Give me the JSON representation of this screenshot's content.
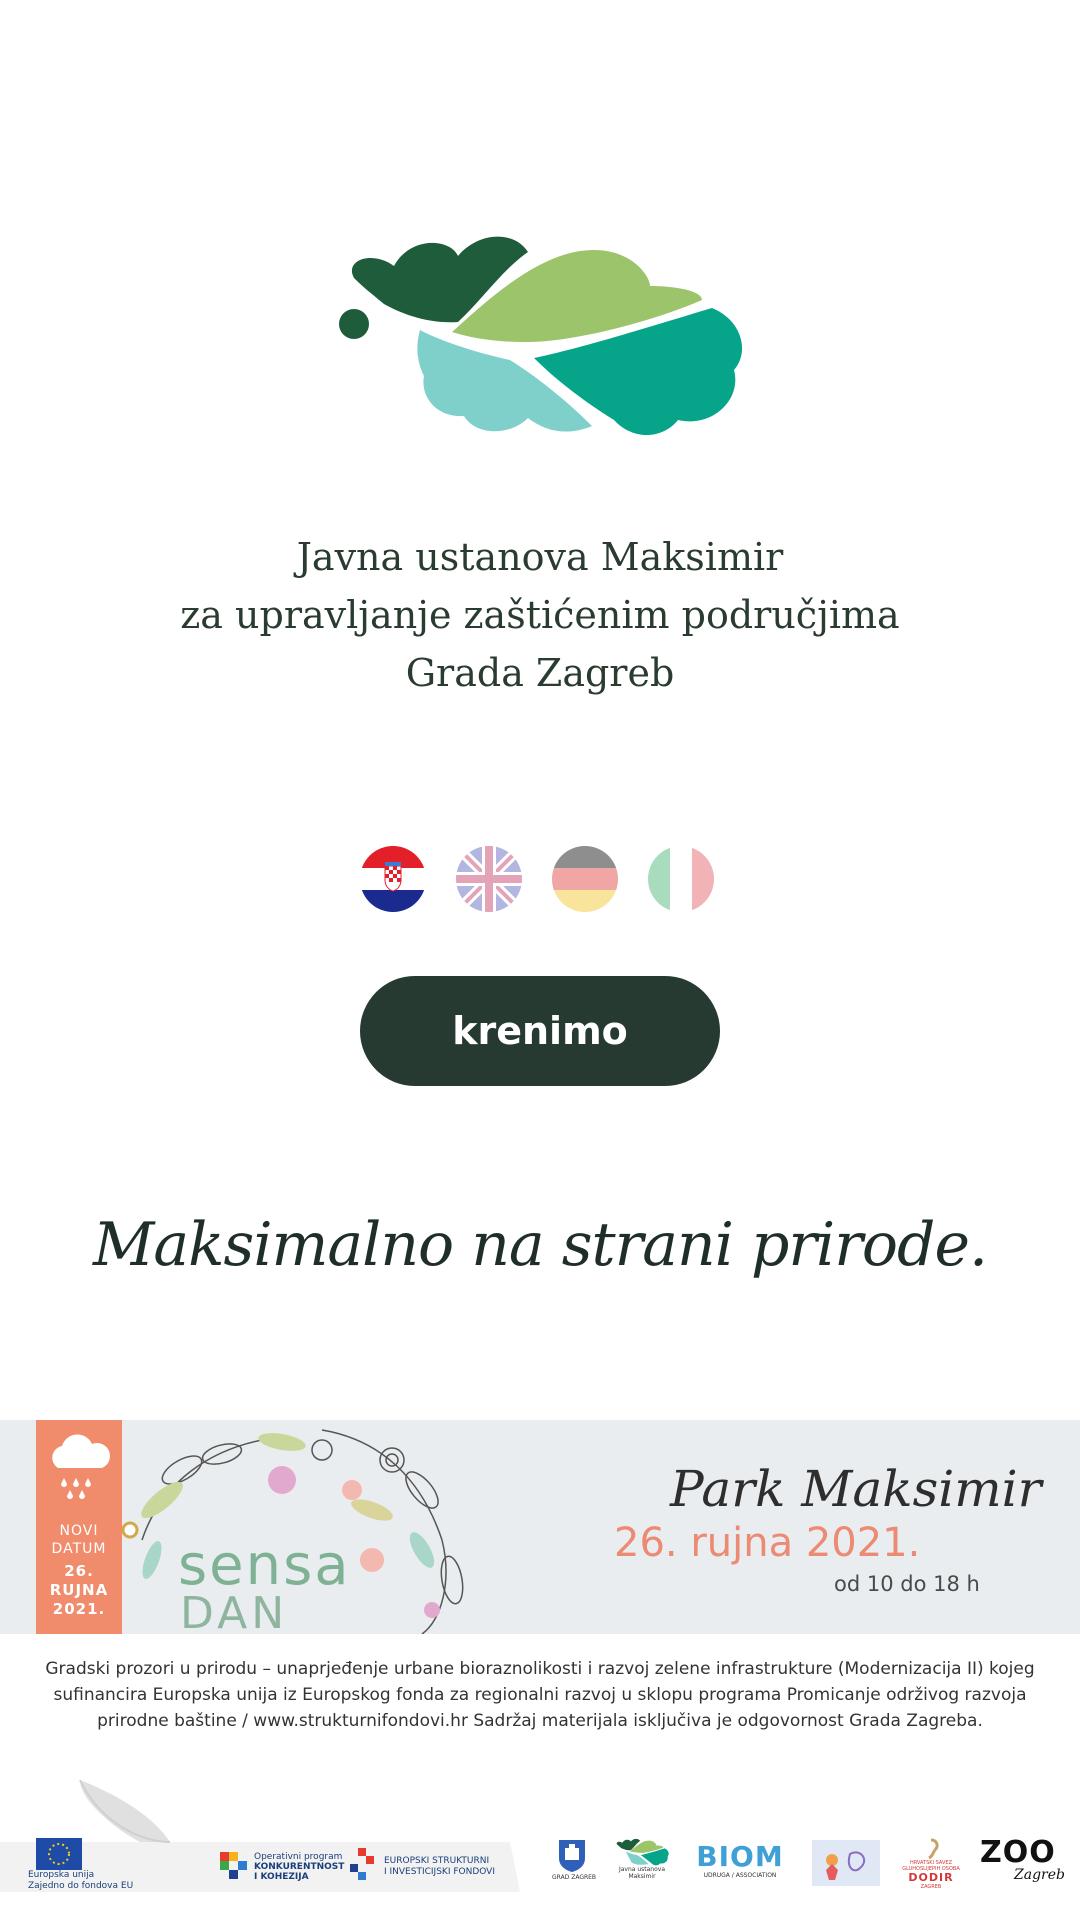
{
  "organization": {
    "title_lines": [
      "Javna ustanova Maksimir",
      "za upravljanje zaštićenim područjima",
      "Grada Zagreb"
    ]
  },
  "languages": [
    {
      "code": "hr",
      "icon": "croatia-flag-icon"
    },
    {
      "code": "en",
      "icon": "uk-flag-icon"
    },
    {
      "code": "de",
      "icon": "germany-flag-icon"
    },
    {
      "code": "it",
      "icon": "italy-flag-icon"
    }
  ],
  "cta": {
    "label": "krenimo"
  },
  "slogan": "Maksimalno na strani prirode.",
  "banner": {
    "calendar_novi": "NOVI",
    "calendar_datum": "DATUM",
    "calendar_day": "26.",
    "calendar_month": "RUJNA",
    "calendar_year": "2021.",
    "event_name_1": "sensa",
    "event_name_2": "DAN",
    "park": "Park Maksimir",
    "date": "26. rujna 2021.",
    "time": "od 10 do 18 h"
  },
  "funding_text": [
    "Gradski prozori u prirodu – unaprjeđenje urbane bioraznolikosti i razvoj zelene infrastrukture (Modernizacija II) kojeg",
    "sufinancira Europska unija iz Europskog fonda za regionalni razvoj u sklopu programa Promicanje održivog razvoja",
    "prirodne baštine / www.strukturnifondovi.hr        Sadržaj materijala isključiva je odgovornost Grada Zagreba."
  ],
  "partner_logos": {
    "eu_line1": "Europska unija",
    "eu_line2": "Zajedno do fondova EU",
    "op_line1": "Operativni program",
    "op_line2": "KONKURENTNOST",
    "op_line3": "I KOHEZIJA",
    "esi_line1": "EUROPSKI STRUKTURNI",
    "esi_line2": "I INVESTICIJSKI FONDOVI",
    "grad": "GRAD ZAGREB",
    "ju_line1": "Javna ustanova",
    "ju_line2": "Maksimir",
    "biom": "BIOM",
    "biom_sub": "UDRUGA / ASSOCIATION",
    "dodir_line1": "HRVATSKI SAVEZ",
    "dodir_line2": "GLUHOSLIJEPIH OSOBA",
    "dodir": "DODIR",
    "dodir_city": "ZAGREB",
    "zoo": "ZOO",
    "zoo_city": "Zagreb"
  },
  "colors": {
    "cta_bg": "#263a32",
    "title": "#2a3b30",
    "leaf_dark": "#1e5c3c",
    "leaf_light": "#9cc46a",
    "leaf_teal": "#06a58a",
    "leaf_aqua": "#7fd0cb",
    "banner_bg": "#e9edef",
    "calendar": "#f08b6c"
  }
}
